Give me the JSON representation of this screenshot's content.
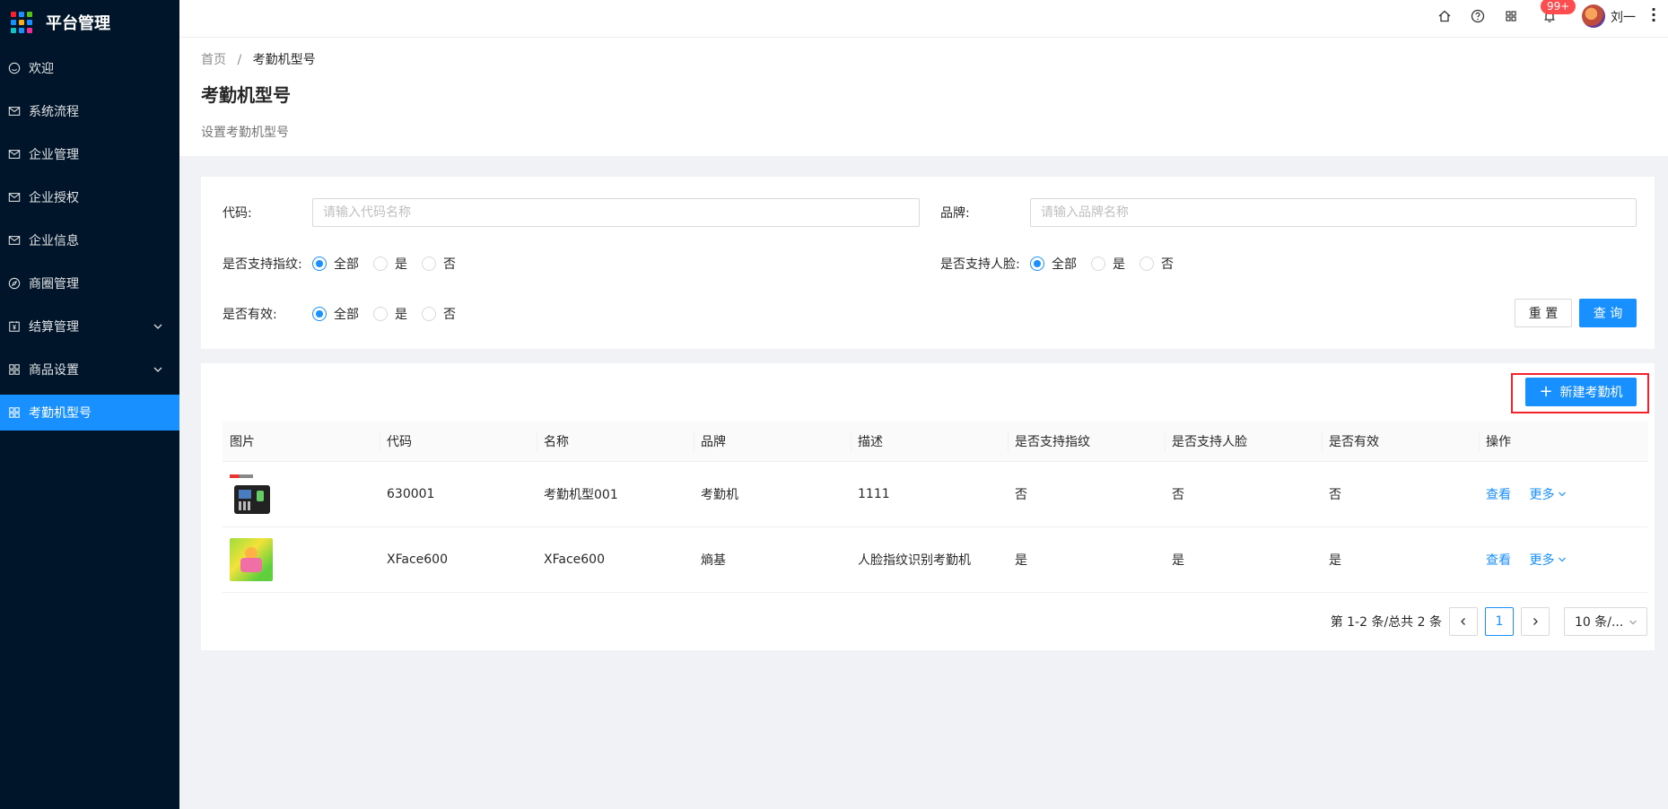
{
  "app": {
    "title": "平台管理",
    "logo_colors": [
      "#f5222d",
      "#1890ff",
      "#52c41a",
      "#1890ff",
      "#faad14",
      "#1890ff",
      "#13c2c2",
      "#1890ff",
      "#eb2f96"
    ]
  },
  "sidebar": {
    "items": [
      {
        "label": "欢迎",
        "icon": "smile-icon"
      },
      {
        "label": "系统流程",
        "icon": "mail-icon"
      },
      {
        "label": "企业管理",
        "icon": "mail-icon"
      },
      {
        "label": "企业授权",
        "icon": "mail-icon"
      },
      {
        "label": "企业信息",
        "icon": "mail-icon"
      },
      {
        "label": "商圈管理",
        "icon": "compass-icon"
      },
      {
        "label": "结算管理",
        "icon": "account-book-icon"
      },
      {
        "label": "商品设置",
        "icon": "appstore-icon"
      },
      {
        "label": "考勤机型号",
        "icon": "appstore-icon",
        "active": true
      }
    ]
  },
  "header": {
    "notification_badge": "99+",
    "username": "刘一",
    "icons": [
      "home-icon",
      "question-icon",
      "appstore-icon",
      "bell-icon"
    ]
  },
  "page": {
    "breadcrumb": [
      "首页",
      "考勤机型号"
    ],
    "separator": "/",
    "title": "考勤机型号",
    "description": "设置考勤机型号"
  },
  "search": {
    "code_label": "代码:",
    "code_placeholder": "请输入代码名称",
    "brand_label": "品牌:",
    "brand_placeholder": "请输入品牌名称",
    "fingerprint_label": "是否支持指纹:",
    "face_label": "是否支持人脸:",
    "valid_label": "是否有效:",
    "options": [
      "全部",
      "是",
      "否"
    ],
    "reset_label": "重 置",
    "query_label": "查 询"
  },
  "table": {
    "new_button": "新建考勤机",
    "columns": [
      "图片",
      "代码",
      "名称",
      "品牌",
      "描述",
      "是否支持指纹",
      "是否支持人脸",
      "是否有效",
      "操作"
    ],
    "rows": [
      {
        "code": "630001",
        "name": "考勤机型001",
        "brand": "考勤机",
        "desc": "1111",
        "fingerprint": "否",
        "face": "否",
        "valid": "否",
        "view": "查看",
        "more": "更多"
      },
      {
        "code": "XFace600",
        "name": "XFace600",
        "brand": "熵基",
        "desc": "人脸指纹识别考勤机",
        "fingerprint": "是",
        "face": "是",
        "valid": "是",
        "view": "查看",
        "more": "更多"
      }
    ]
  },
  "pagination": {
    "total_text": "第 1-2 条/总共 2 条",
    "current_page": "1",
    "page_size": "10 条/..."
  },
  "colors": {
    "primary": "#1890ff",
    "sidebar_bg": "#001529",
    "highlight": "#f5222d"
  }
}
